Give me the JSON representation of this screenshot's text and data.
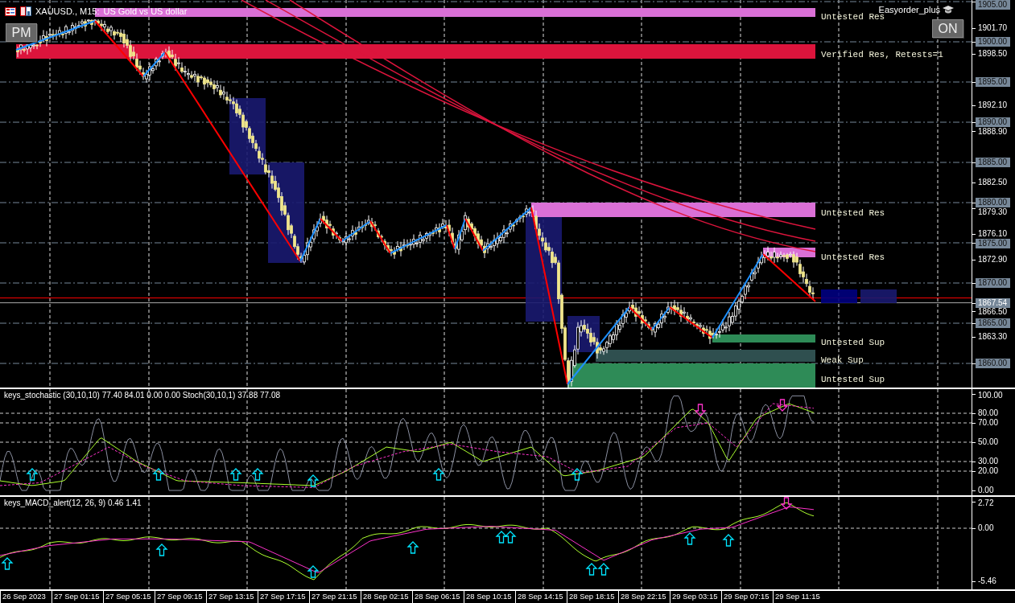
{
  "header": {
    "symbol": "XAUUSD., M15:",
    "description": "US Gold vs US dollar"
  },
  "buttons": [
    {
      "label": "PM"
    },
    {
      "label": "ON"
    }
  ],
  "expert": {
    "name": "Easyorder_plus"
  },
  "zones": [
    {
      "label": "Untested Res",
      "color": "#da70d6"
    },
    {
      "label": "Verified Res, Retests=1",
      "color": "#dc143c"
    },
    {
      "label": "Untested Res",
      "color": "#da70d6"
    },
    {
      "label": "Untested Res",
      "color": "#da70d6"
    },
    {
      "label": "Untested Sup",
      "color": "#2e8b57"
    },
    {
      "label": "Weak Sup",
      "color": "#2f4f4f"
    },
    {
      "label": "Untested Sup",
      "color": "#2e8b57"
    }
  ],
  "price_axis": [
    {
      "text": "1905.00",
      "kind": "level"
    },
    {
      "text": "1901.70",
      "kind": "tick"
    },
    {
      "text": "1900.00",
      "kind": "level"
    },
    {
      "text": "1898.50",
      "kind": "tick"
    },
    {
      "text": "1895.00",
      "kind": "level"
    },
    {
      "text": "1892.10",
      "kind": "tick"
    },
    {
      "text": "1890.00",
      "kind": "level"
    },
    {
      "text": "1888.90",
      "kind": "tick"
    },
    {
      "text": "1885.00",
      "kind": "level"
    },
    {
      "text": "1882.50",
      "kind": "tick"
    },
    {
      "text": "1880.00",
      "kind": "level"
    },
    {
      "text": "1879.30",
      "kind": "tick"
    },
    {
      "text": "1876.10",
      "kind": "tick"
    },
    {
      "text": "1875.00",
      "kind": "level"
    },
    {
      "text": "1872.90",
      "kind": "tick"
    },
    {
      "text": "1870.00",
      "kind": "level"
    },
    {
      "text": "1867.54",
      "kind": "current"
    },
    {
      "text": "1866.50",
      "kind": "tick"
    },
    {
      "text": "1865.00",
      "kind": "level"
    },
    {
      "text": "1863.30",
      "kind": "tick"
    },
    {
      "text": "1860.00",
      "kind": "level"
    }
  ],
  "stochastic": {
    "title": "keys_stochastic (30,10,10) 77.40 84.01 0.00 0.00 Stoch(30,10,1) 37.88 77.08",
    "axis": [
      "100.00",
      "80.00",
      "70.00",
      "50.00",
      "30.00",
      "20.00",
      "0.00"
    ]
  },
  "macd": {
    "title": "keys_MACD_alert(12, 26, 9) 0.46 1.41",
    "axis": [
      "2.72",
      "0.00",
      "-5.46"
    ]
  },
  "time_axis": [
    "26 Sep 2023",
    "27 Sep 01:15",
    "27 Sep 05:15",
    "27 Sep 09:15",
    "27 Sep 13:15",
    "27 Sep 17:15",
    "27 Sep 21:15",
    "28 Sep 02:15",
    "28 Sep 06:15",
    "28 Sep 10:15",
    "28 Sep 14:15",
    "28 Sep 18:15",
    "28 Sep 22:15",
    "29 Sep 03:15",
    "29 Sep 07:15",
    "29 Sep 11:15"
  ]
}
